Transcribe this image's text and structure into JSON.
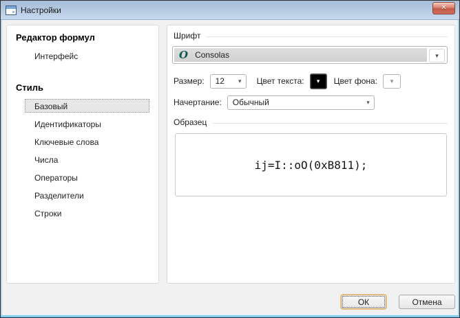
{
  "window": {
    "title": "Настройки"
  },
  "glyphs": {
    "close": "✕",
    "dropdown": "▾",
    "font_type_icon": "O"
  },
  "colors": {
    "titlebar_top": "#a5bbd7",
    "titlebar_bottom": "#c7d9ee",
    "frame_accent": "#7ecdee",
    "selected_item_bg": "#e7e7e7",
    "text_color_swatch": "#000000"
  },
  "sidebar": {
    "sections": [
      {
        "header": "Редактор формул",
        "items": [
          {
            "label": "Интерфейс",
            "selected": false
          }
        ]
      },
      {
        "header": "Стиль",
        "items": [
          {
            "label": "Базовый",
            "selected": true
          },
          {
            "label": "Идентификаторы",
            "selected": false
          },
          {
            "label": "Ключевые слова",
            "selected": false
          },
          {
            "label": "Числа",
            "selected": false
          },
          {
            "label": "Операторы",
            "selected": false
          },
          {
            "label": "Разделители",
            "selected": false
          },
          {
            "label": "Строки",
            "selected": false
          }
        ]
      }
    ]
  },
  "font_panel": {
    "font_group_title": "Шрифт",
    "font_name": "Consolas",
    "size_label": "Размер:",
    "size_value": "12",
    "text_color_label": "Цвет текста:",
    "bg_color_label": "Цвет фона:",
    "style_label": "Начертание:",
    "style_value": "Обычный",
    "sample_group_title": "Образец",
    "sample_text": "ij=I::oO(0xB811);"
  },
  "footer": {
    "ok_label": "ОК",
    "cancel_label": "Отмена"
  }
}
